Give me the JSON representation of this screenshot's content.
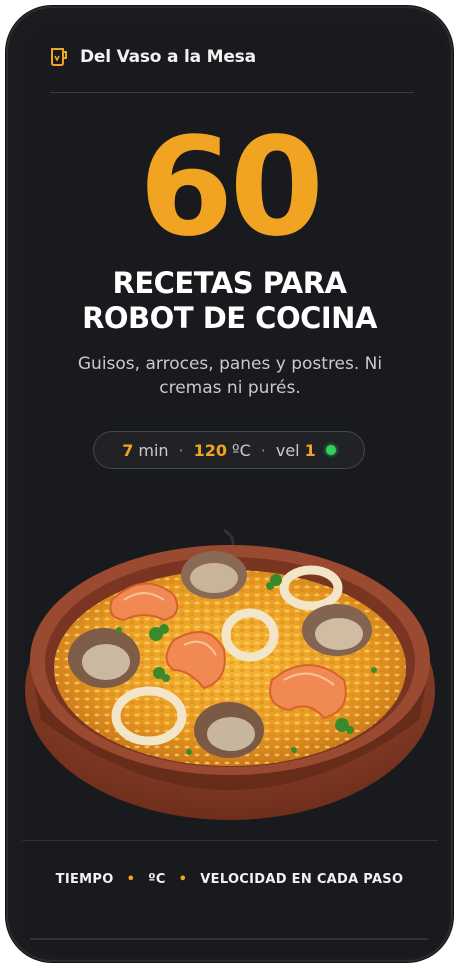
{
  "header": {
    "brand_name": "Del Vaso a la Mesa",
    "logo_icon": "blender-jar-icon"
  },
  "hero": {
    "big_number": "60",
    "title_line1": "RECETAS PARA",
    "title_line2": "ROBOT DE COCINA",
    "subtitle": "Guisos, arroces, panes y postres. Ni cremas ni purés."
  },
  "settings_pill": {
    "time_value": "7",
    "time_unit": "min",
    "temp_value": "120",
    "temp_unit": "ºC",
    "speed_label": "vel",
    "speed_value": "1",
    "status_icon": "green-status-dot"
  },
  "image": {
    "subject": "seafood-rice-dish-icon"
  },
  "footer": {
    "item1": "TIEMPO",
    "item2": "ºC",
    "item3": "VELOCIDAD EN CADA PASO"
  },
  "colors": {
    "accent": "#f0a421",
    "background": "#181a1d",
    "status_green": "#2fd35a"
  }
}
